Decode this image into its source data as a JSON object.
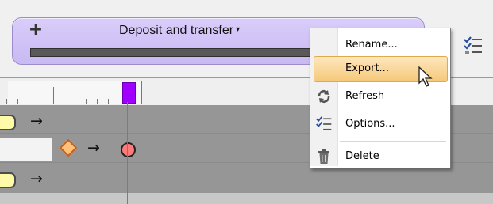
{
  "header": {
    "add_symbol": "+",
    "title": "Deposit and transfer",
    "title_caret": "▾"
  },
  "progress": {
    "fill_percent": 0
  },
  "context_menu": {
    "items": [
      {
        "label": "Rename...",
        "icon": "none"
      },
      {
        "label": "Export...",
        "icon": "none",
        "highlighted": true
      },
      {
        "label": "Refresh",
        "icon": "refresh-icon"
      },
      {
        "label": "Options...",
        "icon": "options-checklist-icon"
      },
      {
        "label": "Delete",
        "icon": "trash-icon"
      }
    ]
  },
  "colors": {
    "panel_purple": "#d4c7f8",
    "playhead_purple": "#a000ff",
    "menu_highlight": "#f6c97a",
    "track_gray": "#969696"
  }
}
